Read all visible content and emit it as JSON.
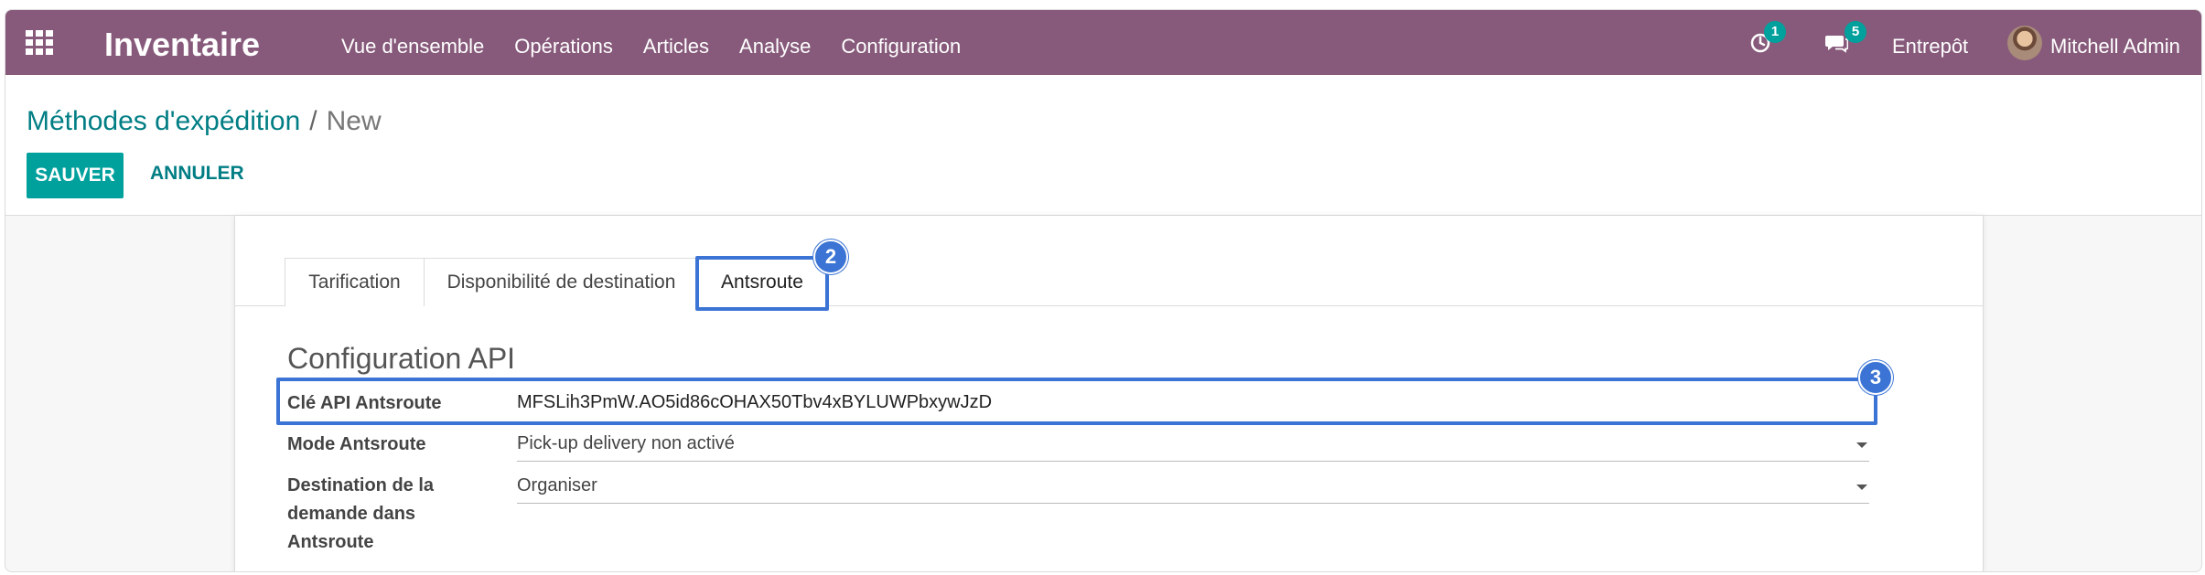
{
  "navbar": {
    "app_title": "Inventaire",
    "menu": [
      "Vue d'ensemble",
      "Opérations",
      "Articles",
      "Analyse",
      "Configuration"
    ],
    "activity_count": "1",
    "message_count": "5",
    "warehouse": "Entrepôt",
    "user": "Mitchell Admin"
  },
  "breadcrumb": {
    "parent": "Méthodes d'expédition",
    "separator": "/",
    "current": "New"
  },
  "actions": {
    "save": "SAUVER",
    "cancel": "ANNULER"
  },
  "tabs": [
    "Tarification",
    "Disponibilité de destination",
    "Antsroute"
  ],
  "markers": [
    "2",
    "3"
  ],
  "section": {
    "title": "Configuration API"
  },
  "fields": {
    "api_key_label": "Clé API Antsroute",
    "api_key_value": "MFSLih3PmW.AO5id86cOHAX50Tbv4xBYLUWPbxywJzD",
    "mode_label": "Mode Antsroute",
    "mode_value": "Pick-up delivery non activé",
    "dest_label": "Destination de la demande dans Antsroute",
    "dest_value": "Organiser"
  },
  "colors": {
    "navbar": "#875a7b",
    "primary": "#00a09d",
    "link": "#017e84",
    "highlight": "#3b74d4"
  }
}
